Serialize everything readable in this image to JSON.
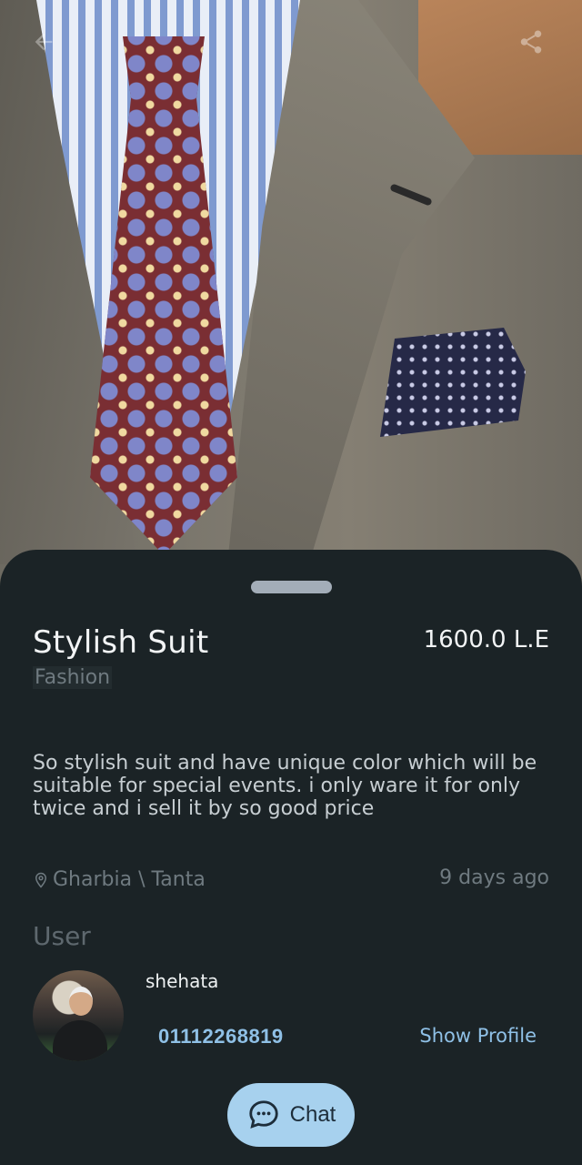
{
  "listing": {
    "title": "Stylish Suit",
    "price": "1600.0 L.E",
    "category": "Fashion",
    "description": "So stylish suit and have unique color which will be suitable for special events. i only ware it for only twice and i sell it by so good price",
    "location": "Gharbia \\ Tanta",
    "posted": "9 days ago"
  },
  "user": {
    "heading": "User",
    "name": "shehata",
    "phone": "01112268819",
    "show_profile_label": "Show Profile"
  },
  "actions": {
    "chat_label": "Chat"
  },
  "icons": {
    "back": "back-arrow-icon",
    "share": "share-icon",
    "location": "location-pin-icon",
    "chat": "chat-bubble-icon"
  },
  "colors": {
    "sheet_bg": "#1b2326",
    "accent": "#8fc0e6",
    "chat_button": "#a7d1ee",
    "muted_text": "#6f7a80"
  }
}
